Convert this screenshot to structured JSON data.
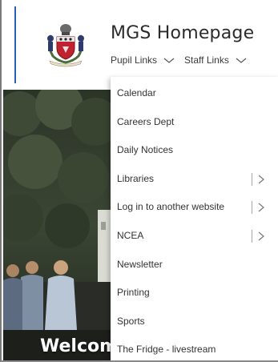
{
  "site": {
    "title": "MGS Homepage"
  },
  "nav": {
    "items": [
      {
        "label": "Pupil Links"
      },
      {
        "label": "Staff Links"
      }
    ]
  },
  "hero": {
    "welcome_text": "Welcom"
  },
  "dropdown": {
    "items": [
      {
        "label": "Calendar",
        "has_submenu": false
      },
      {
        "label": "Careers Dept",
        "has_submenu": false
      },
      {
        "label": "Daily Notices",
        "has_submenu": false
      },
      {
        "label": "Libraries",
        "has_submenu": true
      },
      {
        "label": "Log in to another website",
        "has_submenu": true
      },
      {
        "label": "NCEA",
        "has_submenu": true
      },
      {
        "label": "Newsletter",
        "has_submenu": false
      },
      {
        "label": "Printing",
        "has_submenu": false
      },
      {
        "label": "Sports",
        "has_submenu": false
      },
      {
        "label": "The Fridge - livestream",
        "has_submenu": false
      }
    ]
  },
  "colors": {
    "accent": "#2b5fb3",
    "title_text": "#2b2b2b"
  }
}
